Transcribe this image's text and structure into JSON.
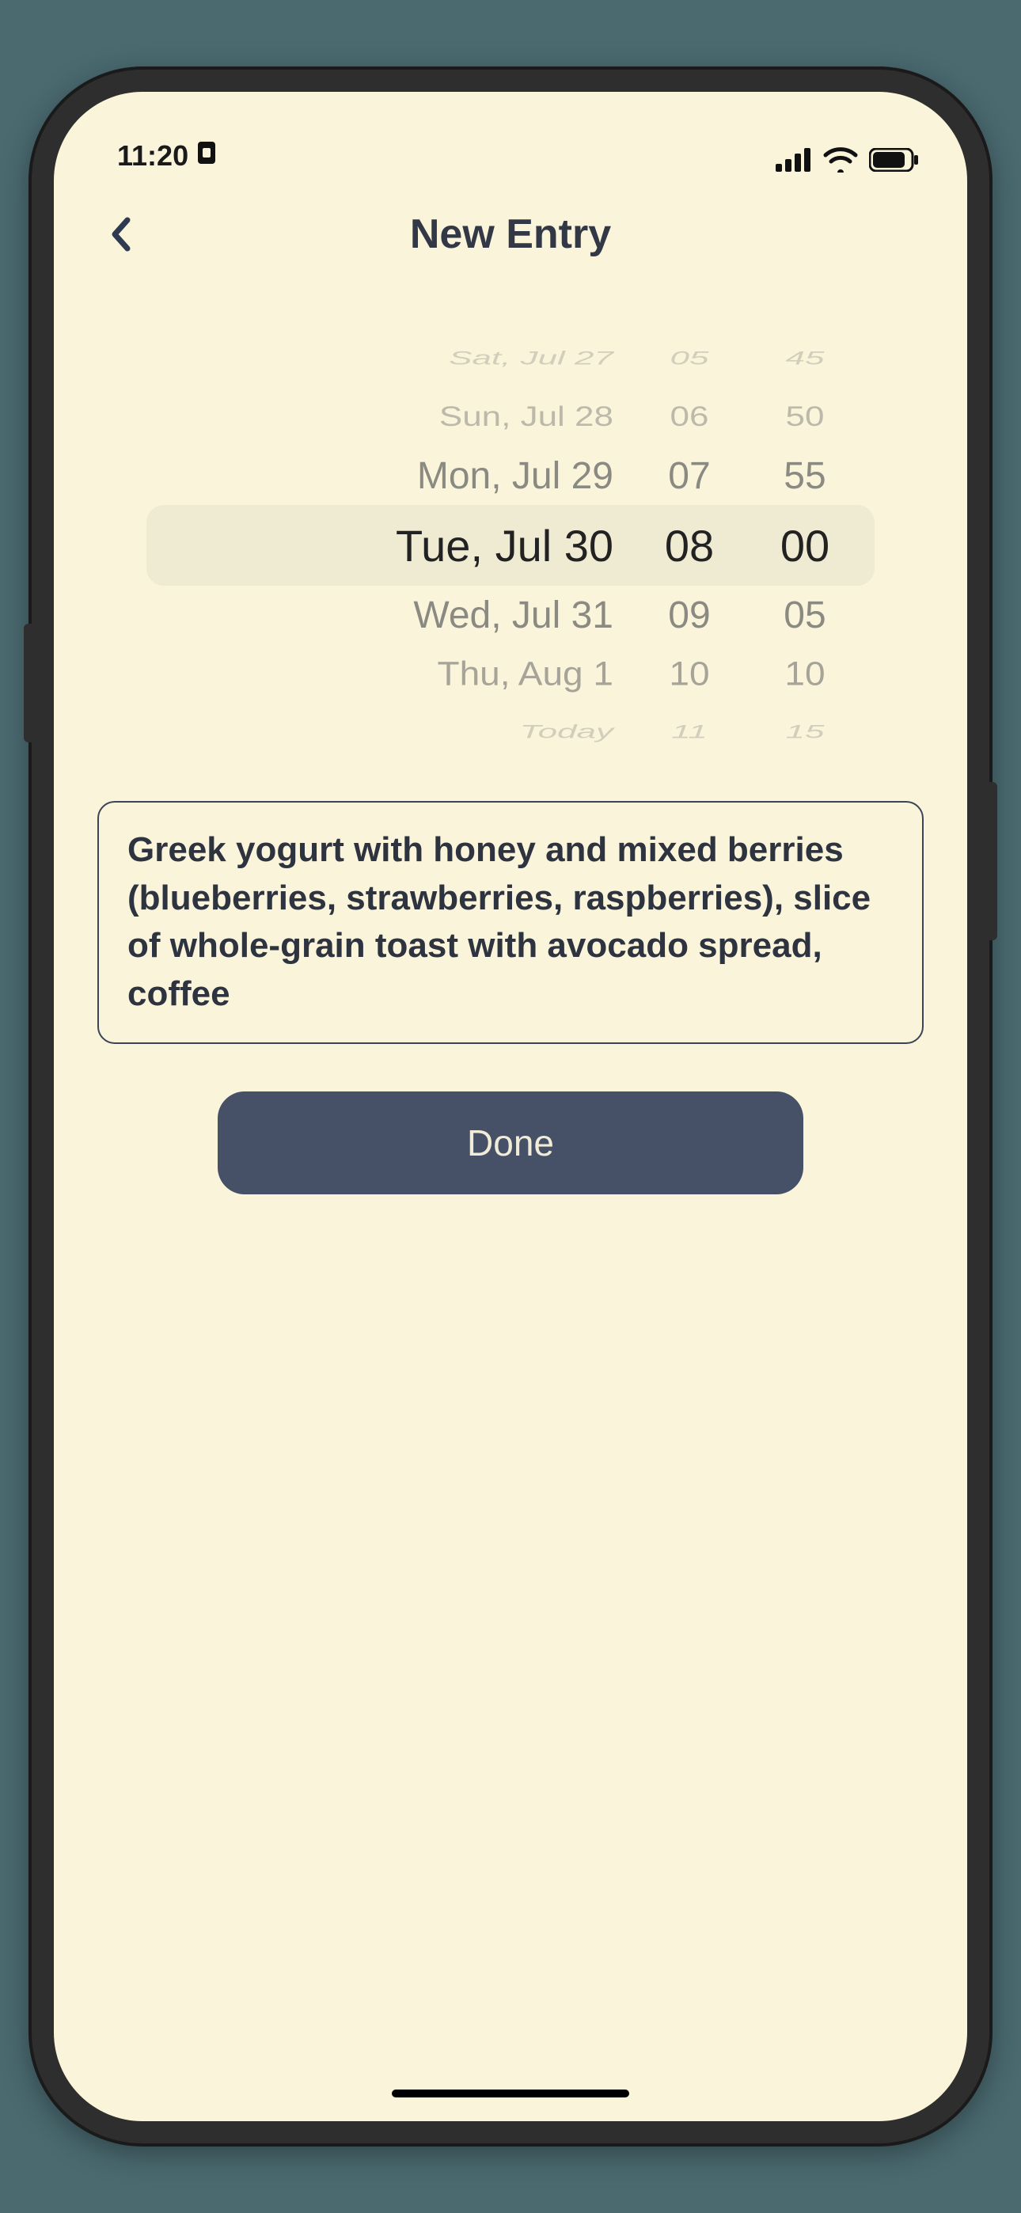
{
  "status": {
    "time": "11:20"
  },
  "header": {
    "title": "New Entry"
  },
  "picker": {
    "rows": [
      {
        "date": "Sat, Jul 27",
        "hour": "05",
        "minute": "45",
        "style": "far"
      },
      {
        "date": "Sun, Jul 28",
        "hour": "06",
        "minute": "50",
        "style": "near2"
      },
      {
        "date": "Mon, Jul 29",
        "hour": "07",
        "minute": "55",
        "style": "adj"
      },
      {
        "date": "Tue, Jul 30",
        "hour": "08",
        "minute": "00",
        "style": "sel"
      },
      {
        "date": "Wed, Jul 31",
        "hour": "09",
        "minute": "05",
        "style": "adj"
      },
      {
        "date": "Thu, Aug 1",
        "hour": "10",
        "minute": "10",
        "style": "near1"
      },
      {
        "date": "Today",
        "hour": "11",
        "minute": "15",
        "style": "far"
      }
    ]
  },
  "entry": {
    "text": "Greek yogurt with honey and mixed berries (blueberries, strawberries, raspberries), slice of whole-grain toast with avocado spread, coffee"
  },
  "buttons": {
    "done": "Done"
  }
}
